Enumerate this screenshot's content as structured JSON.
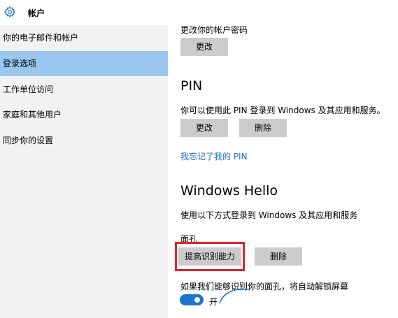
{
  "header": {
    "title": "帐户",
    "icon": "gear-icon"
  },
  "sidebar": {
    "items": [
      {
        "label": "你的电子邮件和帐户",
        "selected": false
      },
      {
        "label": "登录选项",
        "selected": true
      },
      {
        "label": "工作单位访问",
        "selected": false
      },
      {
        "label": "家庭和其他用户",
        "selected": false
      },
      {
        "label": "同步你的设置",
        "selected": false
      }
    ]
  },
  "password": {
    "description": "更改你的帐户密码",
    "change_label": "更改"
  },
  "pin": {
    "title": "PIN",
    "description": "你可以使用此 PIN 登录到 Windows 及其应用和服务。",
    "change_label": "更改",
    "delete_label": "删除",
    "forgot_link": "我忘记了我的 PIN"
  },
  "hello": {
    "title": "Windows Hello",
    "description": "使用以下方式登录到 Windows 及其应用和服务",
    "face_label": "面孔",
    "improve_label": "提高识别能力",
    "delete_label": "删除",
    "auto_unlock_text": "如果我们能够识别你的面孔，将自动解锁屏幕",
    "toggle_state": "开"
  },
  "colors": {
    "accent": "#1b74d1",
    "sidebar_bg": "#f2f2f2",
    "selected_bg": "#99c7ee",
    "button_bg": "#cccccc",
    "highlight": "#e0232a",
    "link": "#1f6fc9"
  }
}
